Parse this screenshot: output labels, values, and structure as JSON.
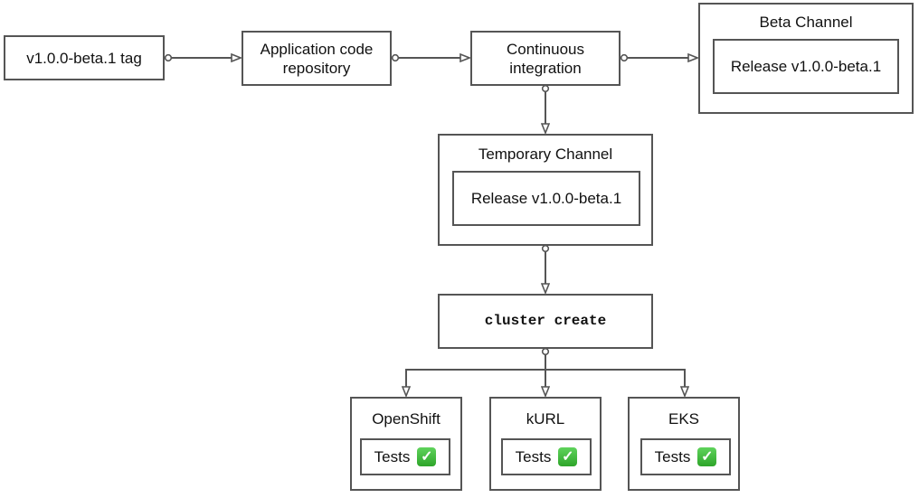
{
  "nodes": {
    "tag": {
      "label": "v1.0.0-beta.1 tag"
    },
    "repo": {
      "label_line1": "Application code",
      "label_line2": "repository"
    },
    "ci": {
      "label_line1": "Continuous",
      "label_line2": "integration"
    },
    "beta_channel": {
      "title": "Beta Channel",
      "release": "Release v1.0.0-beta.1"
    },
    "temp_channel": {
      "title": "Temporary Channel",
      "release": "Release v1.0.0-beta.1"
    },
    "cluster_create": {
      "label": "cluster create"
    },
    "clusters": [
      {
        "name": "OpenShift",
        "tests_label": "Tests",
        "status_icon": "check-mark-icon"
      },
      {
        "name": "kURL",
        "tests_label": "Tests",
        "status_icon": "check-mark-icon"
      },
      {
        "name": "EKS",
        "tests_label": "Tests",
        "status_icon": "check-mark-icon"
      }
    ]
  },
  "edges": [
    {
      "from": "tag",
      "to": "repo"
    },
    {
      "from": "repo",
      "to": "ci"
    },
    {
      "from": "ci",
      "to": "beta_channel"
    },
    {
      "from": "ci",
      "to": "temp_channel"
    },
    {
      "from": "temp_channel",
      "to": "cluster_create"
    },
    {
      "from": "cluster_create",
      "to": "OpenShift"
    },
    {
      "from": "cluster_create",
      "to": "kURL"
    },
    {
      "from": "cluster_create",
      "to": "EKS"
    }
  ],
  "icons": {
    "check_glyph": "✓"
  },
  "colors": {
    "line": "#555555",
    "check_green": "#34b431"
  }
}
